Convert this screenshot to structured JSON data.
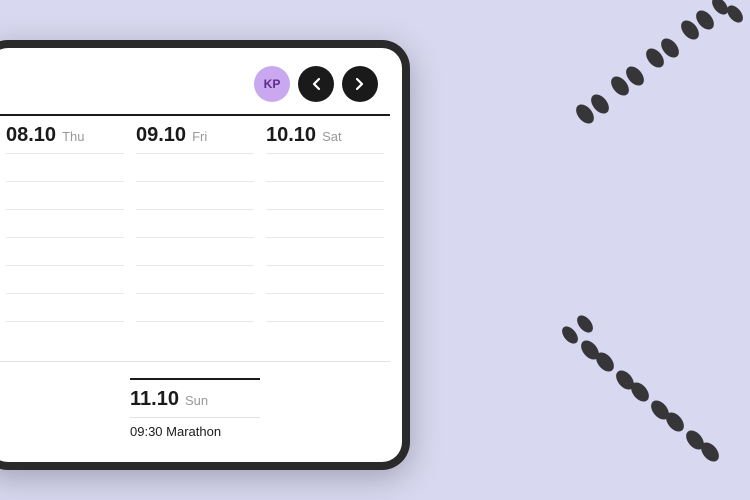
{
  "background_color": "#d8d8f0",
  "tablet": {
    "bg_outer": "#2a2a2a",
    "bg_inner": "#ffffff"
  },
  "header": {
    "avatar_initials": "KP",
    "avatar_bg": "#c9a8f0",
    "prev_label": "‹",
    "next_label": "›"
  },
  "calendar": {
    "days": [
      {
        "date": "08.10",
        "day_name": "Thu"
      },
      {
        "date": "09.10",
        "day_name": "Fri"
      },
      {
        "date": "10.10",
        "day_name": "Sat"
      }
    ],
    "bottom_day": {
      "date": "11.10",
      "day_name": "Sun"
    },
    "event": {
      "time": "09:30",
      "title": "Marathon",
      "display": "09:30 Marathon"
    }
  },
  "footprints": {
    "top_right": "decorative footprint trail top right",
    "bottom_right": "decorative footprint trail bottom right"
  }
}
